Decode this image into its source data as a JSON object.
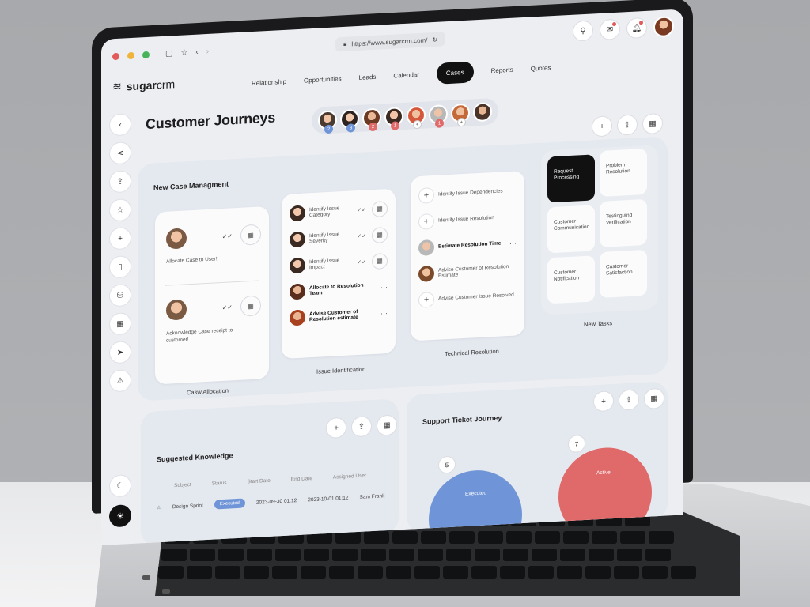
{
  "browser": {
    "url": "https://www.sugarcrm.com/"
  },
  "brand": {
    "name_bold": "sugar",
    "name_light": "crm"
  },
  "nav": [
    "Relationship",
    "Opportunities",
    "Leads",
    "Calendar",
    "Cases",
    "Reports",
    "Quotes"
  ],
  "nav_active": "Cases",
  "page": {
    "title": "Customer Journeys"
  },
  "team_badges": [
    "2",
    "3",
    "2",
    "1",
    "+",
    "1",
    "+"
  ],
  "case_mgmt": {
    "title": "New Case Managment",
    "allocation": {
      "label": "Casw Allocation",
      "items": [
        "Allocate Case to User!",
        "Acknowledge Case receipt to customer!"
      ]
    },
    "issue": {
      "label": "Issue Identification",
      "items": [
        {
          "text": "Identify Issue Category",
          "bold": false
        },
        {
          "text": "Identify Issue Severity",
          "bold": false
        },
        {
          "text": "Identify Issue Impact",
          "bold": false
        },
        {
          "text": "Allocate to Resolution Team",
          "bold": true
        },
        {
          "text": "Advise Customer of Resolution estimate",
          "bold": true
        }
      ]
    },
    "technical": {
      "label": "Technical Resolution",
      "items": [
        {
          "text": "Identify Issue Dependencies",
          "bold": false
        },
        {
          "text": "Identify Issue Resolution",
          "bold": false
        },
        {
          "text": "Estimate Resolution Time",
          "bold": true
        },
        {
          "text": "Advise Customer of Resolution Estimate",
          "bold": false
        },
        {
          "text": "Advise Customer Issue Resolved",
          "bold": false
        }
      ]
    },
    "tasks": {
      "label": "New Tasks",
      "tiles": [
        "Request Processing",
        "Problem Resolution",
        "Customer Communication",
        "Testing and Verification",
        "Customer Notification",
        "Customer Satisfaction"
      ]
    }
  },
  "knowledge": {
    "title": "Suggested Knowledge",
    "columns": [
      "Subject",
      "Starus",
      "Start Date",
      "End Date",
      "Assigned User"
    ],
    "rows": [
      {
        "subject": "Design Sprint",
        "status": "Executed",
        "start": "2023-09-30 01:12",
        "end": "2023-10-01 01:12",
        "user": "Sam Frank"
      }
    ],
    "header_user": "Sam Frank"
  },
  "ticket": {
    "title": "Support Ticket Journey",
    "executed": {
      "label": "Executed",
      "count": "5"
    },
    "active": {
      "label": "Active",
      "count": "7"
    }
  },
  "colors": {
    "executed": "#6f95d8",
    "active": "#e06a6a",
    "accent": "#111111"
  }
}
